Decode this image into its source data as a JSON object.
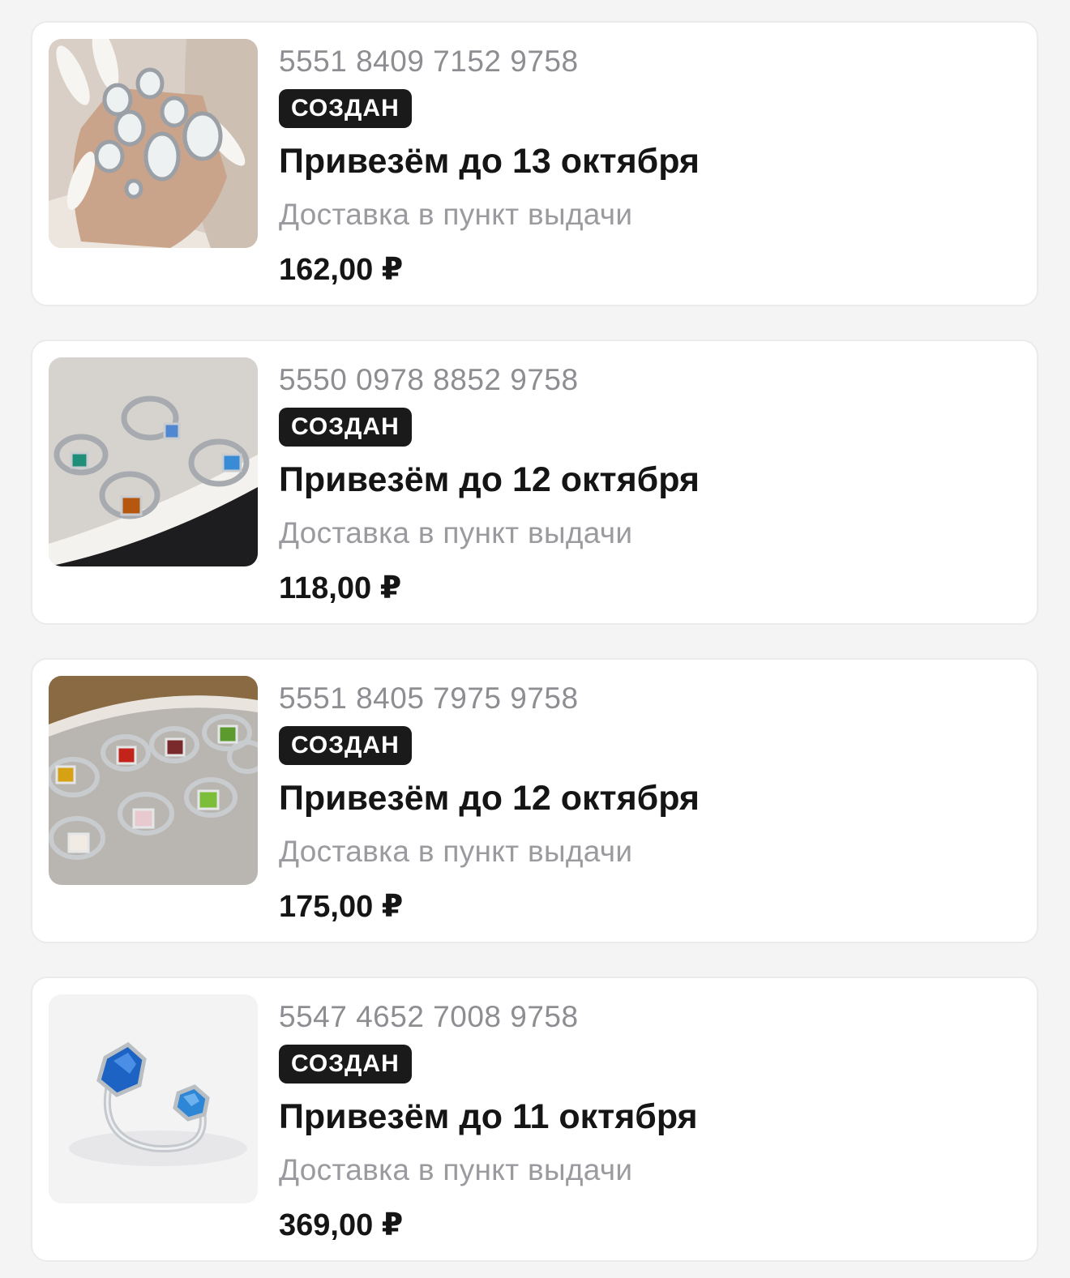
{
  "orders": [
    {
      "number": "5551 8409 7152 9758",
      "status": "СОЗДАН",
      "delivery_date": "Привезём до 13 октября",
      "delivery_method": "Доставка в пункт выдачи",
      "price": "162,00 ₽",
      "image": "silver-opal-rings-on-hand"
    },
    {
      "number": "5550 0978 8852 9758",
      "status": "СОЗДАН",
      "delivery_date": "Привезём до 12 октября",
      "delivery_method": "Доставка в пункт выдачи",
      "price": "118,00 ₽",
      "image": "silver-rings-with-colored-stones"
    },
    {
      "number": "5551 8405 7975 9758",
      "status": "СОЗДАН",
      "delivery_date": "Привезём до 12 октября",
      "delivery_method": "Доставка в пункт выдачи",
      "price": "175,00 ₽",
      "image": "crystal-rings-in-box"
    },
    {
      "number": "5547 4652 7008 9758",
      "status": "СОЗДАН",
      "delivery_date": "Привезём до 11 октября",
      "delivery_method": "Доставка в пункт выдачи",
      "price": "369,00 ₽",
      "image": "blue-crystal-open-ring"
    }
  ],
  "colors": {
    "background": "#f4f4f5",
    "card": "#ffffff",
    "badge": "#1a1a1a",
    "muted_text": "#9a9a9f",
    "main_text": "#151515"
  }
}
